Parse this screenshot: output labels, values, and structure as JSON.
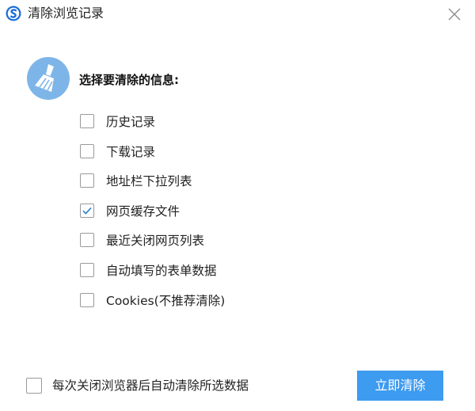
{
  "window": {
    "title": "清除浏览记录",
    "app_icon": "sogou-browser-icon",
    "close_icon": "close-icon"
  },
  "header": {
    "icon": "broom-icon",
    "title": "选择要清除的信息:"
  },
  "options": [
    {
      "label": "历史记录",
      "checked": false
    },
    {
      "label": "下载记录",
      "checked": false
    },
    {
      "label": "地址栏下拉列表",
      "checked": false
    },
    {
      "label": "网页缓存文件",
      "checked": true
    },
    {
      "label": "最近关闭网页列表",
      "checked": false
    },
    {
      "label": "自动填写的表单数据",
      "checked": false
    },
    {
      "label": "Cookies(不推荐清除)",
      "checked": false
    }
  ],
  "footer": {
    "auto_clear_label": "每次关闭浏览器后自动清除所选数据",
    "auto_clear_checked": false,
    "clear_button_label": "立即清除"
  },
  "colors": {
    "accent": "#3d9bf0",
    "icon_circle": "#7eb5e8",
    "checkmark": "#2a7fd4"
  }
}
